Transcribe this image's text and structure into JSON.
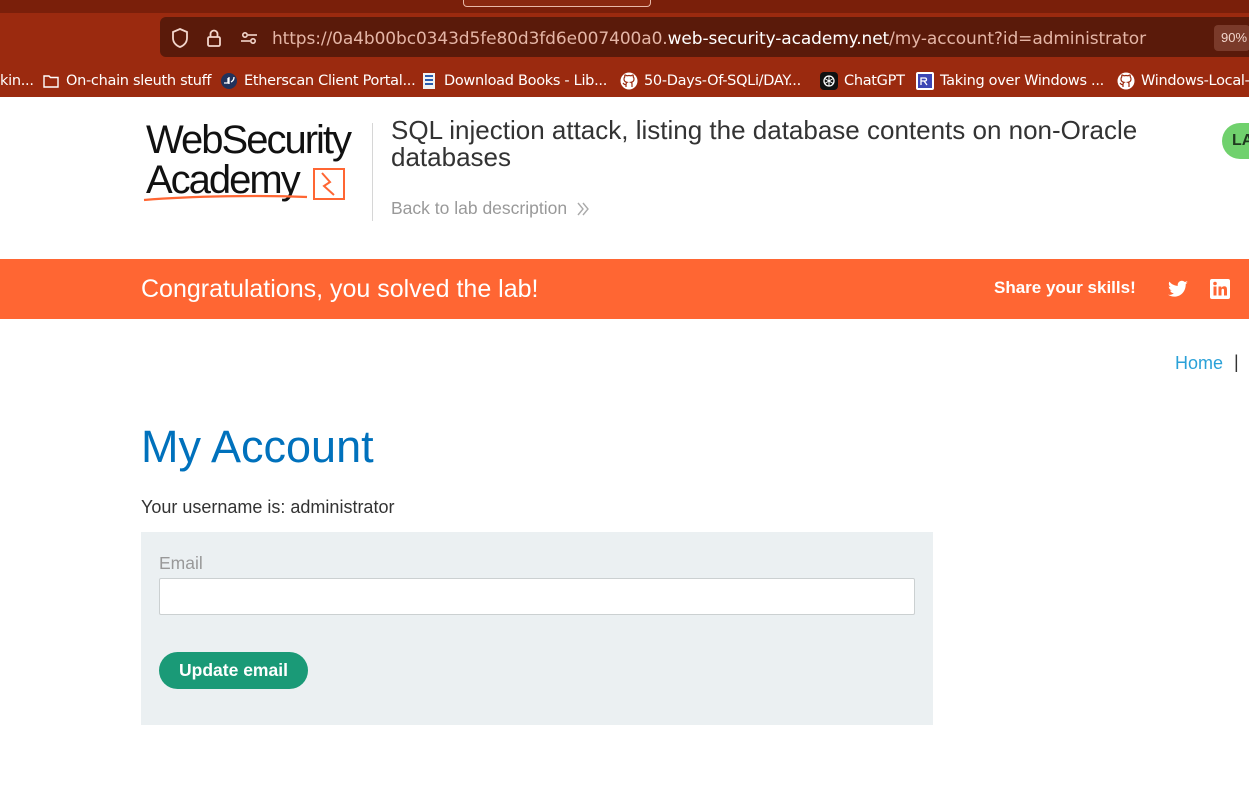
{
  "browser": {
    "url_prefix": "https://0a4b00bc0343d5fe80d3fd6e007400a0.",
    "url_host": "web-security-academy.net",
    "url_path": "/my-account?id=administrator",
    "zoom": "90%",
    "bookmarks": [
      {
        "label": "kin...",
        "icon": "none"
      },
      {
        "label": "On-chain sleuth stuff",
        "icon": "folder-icon"
      },
      {
        "label": "Etherscan Client Portal...",
        "icon": "etherscan-icon"
      },
      {
        "label": "Download Books - Lib...",
        "icon": "library-icon"
      },
      {
        "label": "50-Days-Of-SQLi/DAY...",
        "icon": "github-icon"
      },
      {
        "label": "ChatGPT",
        "icon": "chatgpt-icon"
      },
      {
        "label": "Taking over Windows ...",
        "icon": "site-icon"
      },
      {
        "label": "Windows-Local-",
        "icon": "github-icon"
      }
    ]
  },
  "lab": {
    "logo_line1": "WebSecurity",
    "logo_line2": "Academy",
    "title": "SQL injection attack, listing the database contents on non-Oracle databases",
    "back_link": "Back to lab description",
    "badge": "LA"
  },
  "banner": {
    "message": "Congratulations, you solved the lab!",
    "share": "Share your skills!"
  },
  "nav": {
    "home": "Home",
    "separator": "|"
  },
  "account": {
    "title": "My Account",
    "username_line": "Your username is: administrator",
    "email_label": "Email",
    "email_value": "",
    "update_button": "Update email"
  },
  "colors": {
    "accent_orange": "#ff6633",
    "title_blue": "#0071bc",
    "button_green": "#1a9a77",
    "browser_chrome": "#9b2a0f"
  }
}
